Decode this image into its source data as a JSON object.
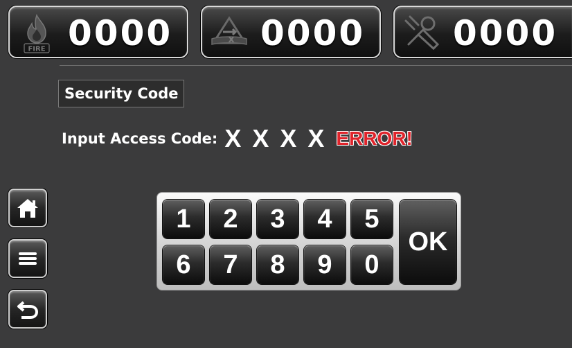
{
  "counters": {
    "fire": {
      "icon": "fire-icon",
      "icon_text": "FIRE",
      "value": "0000"
    },
    "fault": {
      "icon": "fault-icon",
      "value": "0000"
    },
    "maintenance": {
      "icon": "tools-icon",
      "value": "0000"
    }
  },
  "security": {
    "title": "Security Code",
    "input_label": "Input Access Code:",
    "code_mask": "X X X X",
    "error": "ERROR!"
  },
  "side_buttons": {
    "home": "home-icon",
    "menu": "menu-icon",
    "back": "back-icon"
  },
  "keypad": {
    "row1": [
      "1",
      "2",
      "3",
      "4",
      "5"
    ],
    "row2": [
      "6",
      "7",
      "8",
      "9",
      "0"
    ],
    "ok": "OK"
  },
  "colors": {
    "background": "#3b3b3c",
    "error": "#e0242b",
    "key": "#1a1a1a",
    "keypad_frame": "#d6d6d6"
  }
}
